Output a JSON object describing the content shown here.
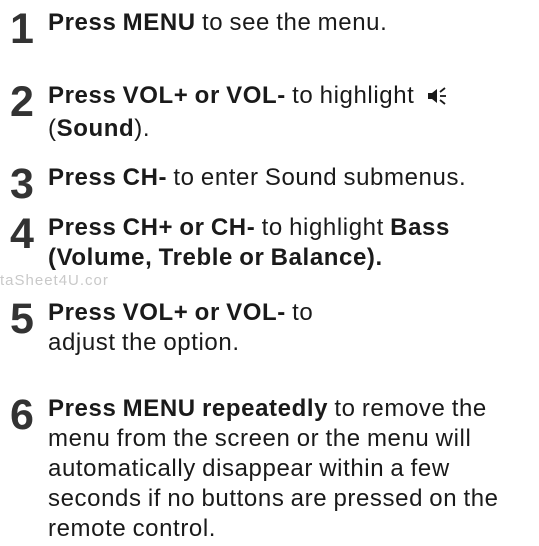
{
  "steps": [
    {
      "number": "1",
      "bold1": "Press MENU",
      "text1": " to see the menu."
    },
    {
      "number": "2",
      "bold1": "Press VOL+ or VOL-",
      "text1": " to highlight ",
      "icon": "speaker-icon",
      "text2": "(",
      "bold2": "Sound",
      "text3": ")."
    },
    {
      "number": "3",
      "bold1": "Press CH-",
      "text1": " to enter Sound submenus."
    },
    {
      "number": "4",
      "bold1": "Press CH+ or CH-",
      "text1": " to highlight ",
      "bold2": "Bass (Volume, Treble or Balance",
      "text2": ")."
    },
    {
      "number": "5",
      "bold1": "Press VOL+ or VOL-",
      "text1": " to adjust the option."
    },
    {
      "number": "6",
      "bold1": "Press MENU repeatedly",
      "text1": " to remove the menu from the screen or the menu will automatically disappear within a few seconds if no buttons are pressed on the remote control."
    }
  ],
  "watermark": "taSheet4U.cor"
}
